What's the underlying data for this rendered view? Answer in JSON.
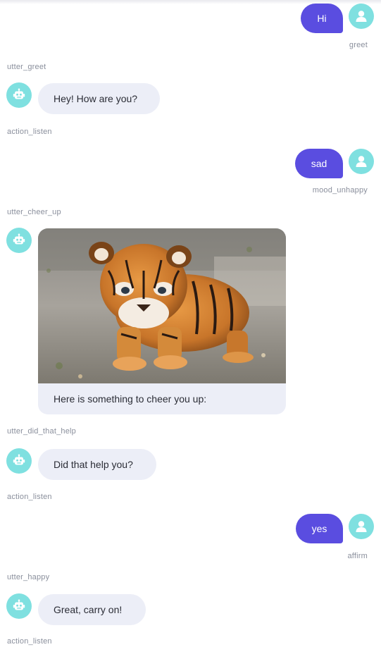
{
  "colors": {
    "user_bubble": "#5a4de0",
    "bot_bubble": "#eceef7",
    "avatar": "#7fe0e0",
    "label": "#8a8f9c"
  },
  "icons": {
    "user_avatar": "user-icon",
    "bot_avatar": "robot-icon"
  },
  "chat": {
    "m1": {
      "text": "Hi",
      "intent": "greet"
    },
    "a1": "utter_greet",
    "b1": "Hey! How are you?",
    "a2": "action_listen",
    "m2": {
      "text": "sad",
      "intent": "mood_unhappy"
    },
    "a3": "utter_cheer_up",
    "b2": {
      "image_alt": "tiger cub",
      "caption": "Here is something to cheer you up:"
    },
    "a4": "utter_did_that_help",
    "b3": "Did that help you?",
    "a5": "action_listen",
    "m3": {
      "text": "yes",
      "intent": "affirm"
    },
    "a6": "utter_happy",
    "b4": "Great, carry on!",
    "a7": "action_listen"
  }
}
